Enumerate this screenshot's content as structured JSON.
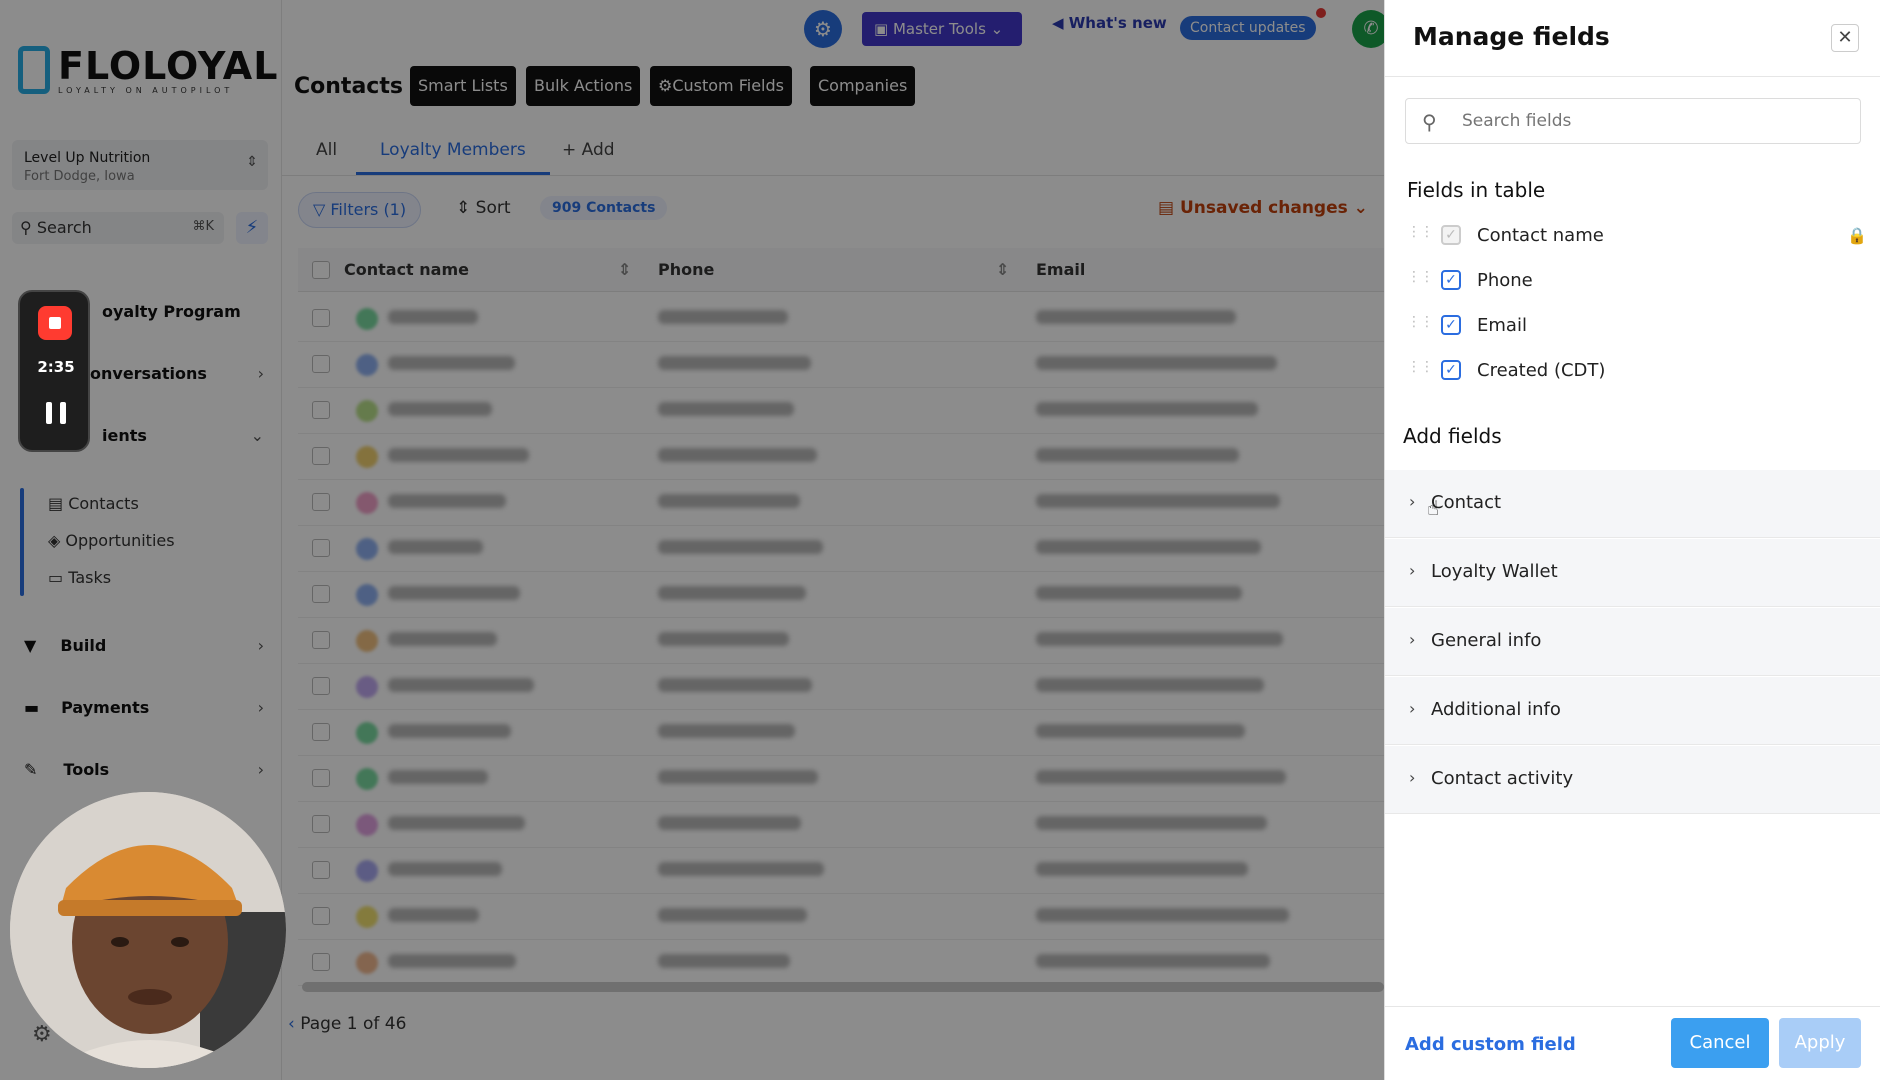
{
  "brand": {
    "name": "FLOLOYAL",
    "tagline": "LOYALTY ON AUTOPILOT"
  },
  "location": {
    "name": "Level Up Nutrition",
    "city": "Fort Dodge, Iowa"
  },
  "search": {
    "label": "Search",
    "shortcut": "⌘K"
  },
  "recorder": {
    "time": "2:35"
  },
  "sidebar": {
    "loyalty": "oyalty Program",
    "conversations": "onversations",
    "clients": "ients",
    "sub": [
      "Contacts",
      "Opportunities",
      "Tasks"
    ],
    "build": "Build",
    "payments": "Payments",
    "tools": "Tools"
  },
  "topbar": {
    "master_tools": "Master Tools",
    "whats_new": "What's new",
    "contact_updates": "Contact updates"
  },
  "page": {
    "title": "Contacts",
    "pills": [
      "Smart Lists",
      "Bulk Actions",
      "Custom Fields",
      "Companies"
    ],
    "tabs": [
      "All",
      "Loyalty Members",
      "+ Add"
    ],
    "filters": "Filters (1)",
    "sort": "Sort",
    "count": "909 Contacts",
    "unsaved": "Unsaved changes",
    "columns": [
      "Contact name",
      "Phone",
      "Email"
    ],
    "pager": "Page 1 of 46"
  },
  "panel": {
    "title": "Manage fields",
    "search_placeholder": "Search fields",
    "fields_in_table_heading": "Fields in table",
    "fields_in_table": [
      "Contact name",
      "Phone",
      "Email",
      "Created (CDT)"
    ],
    "add_fields_heading": "Add fields",
    "groups": [
      "Contact",
      "Loyalty Wallet",
      "General info",
      "Additional info",
      "Contact activity"
    ],
    "add_custom_field": "Add custom field",
    "cancel": "Cancel",
    "apply": "Apply"
  },
  "colors": {
    "accent": "#2b6de0",
    "master_tools": "#4338ca",
    "warning": "#c2410c",
    "record": "#ff3b30"
  }
}
